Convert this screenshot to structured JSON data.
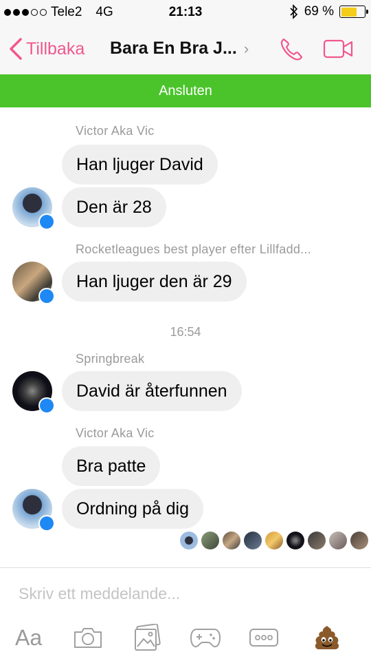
{
  "status_bar": {
    "carrier": "Tele2",
    "network": "4G",
    "time": "21:13",
    "battery": "69 %",
    "battery_level": 0.69,
    "signal_bars_filled": 3,
    "signal_bars_total": 5
  },
  "nav": {
    "back_label": "Tillbaka",
    "title": "Bara En Bra J...",
    "title_chevron": "›",
    "accent_color": "#f0578e"
  },
  "banner": {
    "text": "Ansluten",
    "color": "#4bc42c"
  },
  "messages": {
    "group1": {
      "sender": "Victor Aka Vic",
      "m1": "Han ljuger David",
      "m2": "Den är 28"
    },
    "group2": {
      "sender": "Rocketleagues best player efter Lillfadd...",
      "m1": "Han ljuger den är 29"
    },
    "timestamp": "16:54",
    "group3": {
      "sender": "Springbreak",
      "m1": "David är återfunnen"
    },
    "group4": {
      "sender": "Victor Aka Vic",
      "m1": "Bra patte",
      "m2": "Ordning på dig"
    }
  },
  "composer": {
    "placeholder": "Skriv ett meddelande...",
    "aa_label": "Aa",
    "icons": [
      "text-format-icon",
      "camera-icon",
      "gallery-icon",
      "game-controller-icon",
      "more-icon",
      "poop-emoji-icon"
    ]
  }
}
